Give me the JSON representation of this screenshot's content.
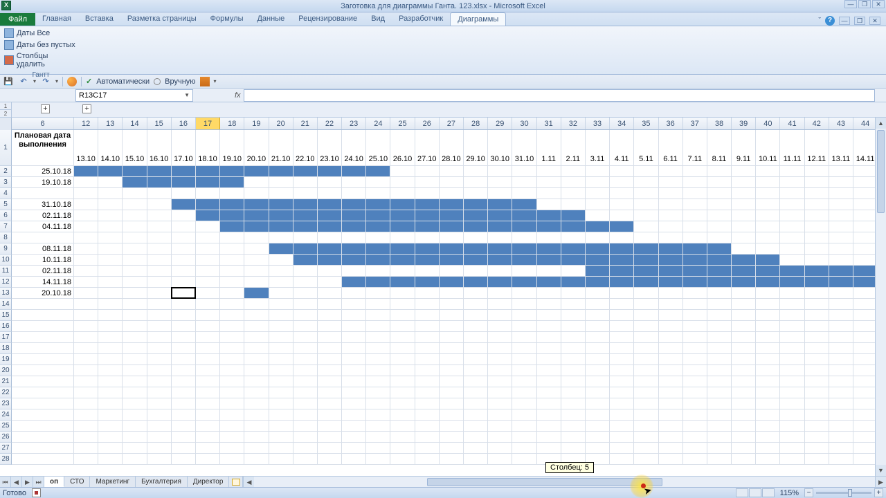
{
  "title": "Заготовка для диаграммы Ганта. 123.xlsx - Microsoft Excel",
  "ribbon_tabs": {
    "file": "Файл",
    "items": [
      "Главная",
      "Вставка",
      "Разметка страницы",
      "Формулы",
      "Данные",
      "Рецензирование",
      "Вид",
      "Разработчик",
      "Диаграммы"
    ],
    "active": "Диаграммы"
  },
  "ribbon_group": {
    "label": "Гантт",
    "items": [
      "Даты Все",
      "Даты без пустых",
      "Столбцы удалить"
    ]
  },
  "qat": {
    "auto": "Автоматически",
    "manual": "Вручную"
  },
  "name_box": "R13C17",
  "columns": [
    "6",
    "12",
    "13",
    "14",
    "15",
    "16",
    "17",
    "18",
    "19",
    "20",
    "21",
    "22",
    "23",
    "24",
    "25",
    "26",
    "27",
    "28",
    "29",
    "30",
    "31",
    "32",
    "33",
    "34",
    "35",
    "36",
    "37",
    "38",
    "39",
    "40",
    "41",
    "42",
    "43",
    "44"
  ],
  "selected_col_index": 6,
  "col_width": 35.2,
  "header_row": {
    "first": "Плановая дата выполнения",
    "dates": [
      "13.10",
      "14.10",
      "15.10",
      "16.10",
      "17.10",
      "18.10",
      "19.10",
      "20.10",
      "21.10",
      "22.10",
      "23.10",
      "24.10",
      "25.10",
      "26.10",
      "27.10",
      "28.10",
      "29.10",
      "30.10",
      "31.10",
      "1.11",
      "2.11",
      "3.11",
      "4.11",
      "5.11",
      "6.11",
      "7.11",
      "8.11",
      "9.11",
      "10.11",
      "11.11",
      "12.11",
      "13.11",
      "14.11"
    ]
  },
  "rows": [
    {
      "n": 1,
      "header": true
    },
    {
      "n": 2,
      "label": "25.10.18",
      "bar": [
        0,
        13
      ]
    },
    {
      "n": 3,
      "label": "19.10.18",
      "bar": [
        2,
        7
      ]
    },
    {
      "n": 4,
      "label": ""
    },
    {
      "n": 5,
      "label": "31.10.18",
      "bar": [
        4,
        19
      ]
    },
    {
      "n": 6,
      "label": "02.11.18",
      "bar": [
        5,
        21
      ]
    },
    {
      "n": 7,
      "label": "04.11.18",
      "bar": [
        6,
        23
      ]
    },
    {
      "n": 8,
      "label": ""
    },
    {
      "n": 9,
      "label": "08.11.18",
      "bar": [
        8,
        27
      ]
    },
    {
      "n": 10,
      "label": "10.11.18",
      "bar": [
        9,
        29
      ]
    },
    {
      "n": 11,
      "label": "02.11.18",
      "bar": [
        21,
        33
      ]
    },
    {
      "n": 12,
      "label": "14.11.18",
      "bar": [
        11,
        33
      ]
    },
    {
      "n": 13,
      "label": "20.10.18",
      "bar": [
        7,
        8
      ]
    },
    {
      "n": 14
    },
    {
      "n": 15
    },
    {
      "n": 16
    },
    {
      "n": 17
    },
    {
      "n": 18
    },
    {
      "n": 19
    },
    {
      "n": 20
    },
    {
      "n": 21
    },
    {
      "n": 22
    },
    {
      "n": 23
    },
    {
      "n": 24
    },
    {
      "n": 25
    },
    {
      "n": 26
    },
    {
      "n": 27
    },
    {
      "n": 28
    }
  ],
  "selected_cell": {
    "row": 13,
    "col": 5
  },
  "tooltip": "Столбец: 5",
  "sheets": {
    "items": [
      "оп",
      "СТО",
      "Маркетинг",
      "Бухгалтерия",
      "Директор"
    ],
    "active": "оп"
  },
  "status": {
    "ready": "Готово",
    "zoom": "115%"
  }
}
